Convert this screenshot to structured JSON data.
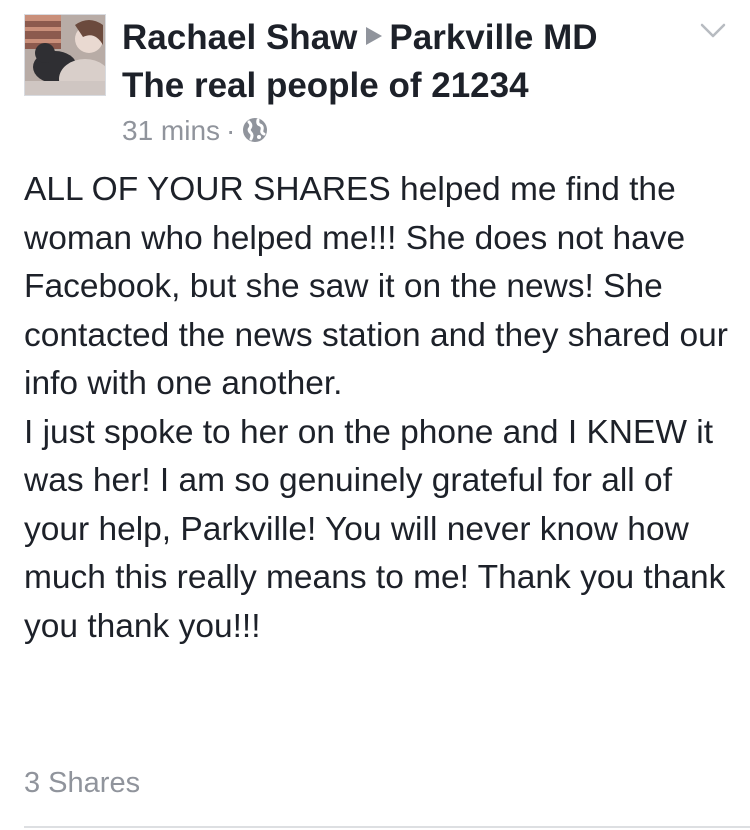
{
  "post": {
    "author": "Rachael Shaw",
    "group_line1": "Parkville MD",
    "group_line2": "The real people of 21234",
    "timestamp": "31 mins",
    "separator": "·",
    "privacy_icon": "globe-icon",
    "menu_icon": "chevron-down-icon",
    "paragraph1": "ALL OF YOUR SHARES helped me find the woman who helped me!!! She does not have Facebook, but she saw it on the news! She contacted the news station and they shared our info with one another.",
    "paragraph2": "I just spoke to her on the phone and I KNEW it was her! I am so genuinely grateful for all of your help, Parkville! You will never know how much this really means to me! Thank you thank you thank you!!!",
    "shares": "3 Shares"
  },
  "colors": {
    "text": "#1d2129",
    "meta": "#90949c",
    "divider": "#dddfe2"
  }
}
